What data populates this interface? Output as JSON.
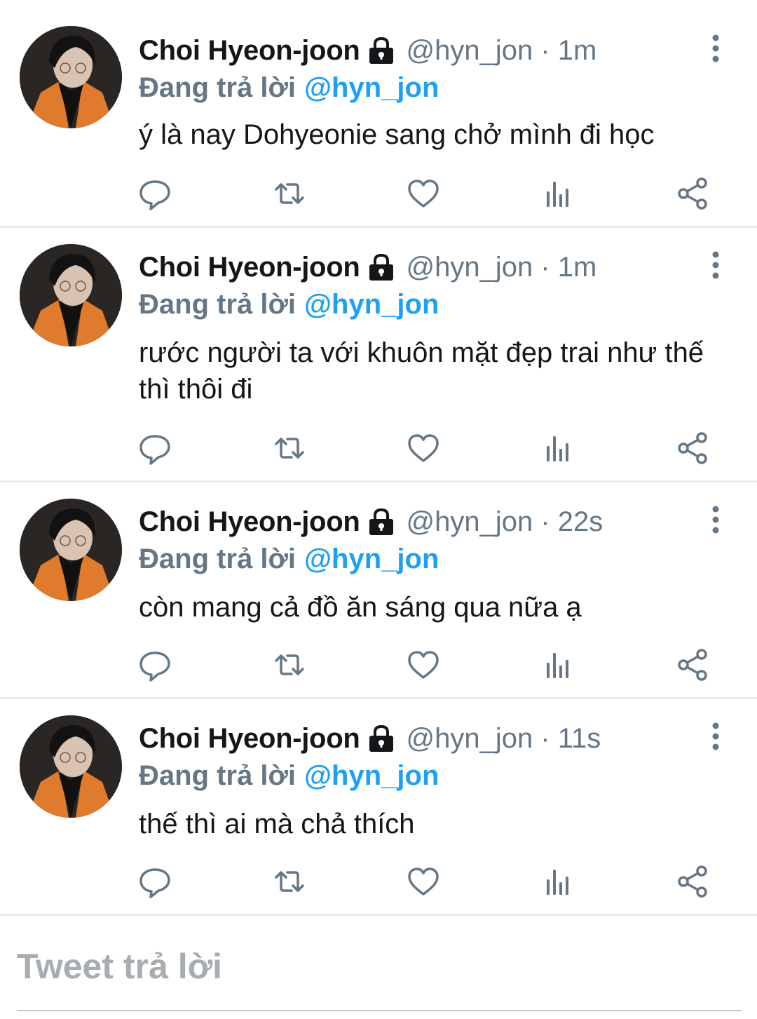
{
  "colors": {
    "text": "#14171a",
    "secondary": "#657786",
    "accent": "#1da1f2",
    "divider": "#e8ecef"
  },
  "tweets": [
    {
      "display_name": "Choi Hyeon-joon",
      "handle_time": "@hyn_jon · 1m",
      "reply_prefix": "Đang trả lời",
      "reply_target": "@hyn_jon",
      "text": "ý là nay Dohyeonie sang chở mình đi học"
    },
    {
      "display_name": "Choi Hyeon-joon",
      "handle_time": "@hyn_jon · 1m",
      "reply_prefix": "Đang trả lời",
      "reply_target": "@hyn_jon",
      "text": "rước người ta với khuôn mặt đẹp trai như thế thì thôi đi"
    },
    {
      "display_name": "Choi Hyeon-joon",
      "handle_time": "@hyn_jon · 22s",
      "reply_prefix": "Đang trả lời",
      "reply_target": "@hyn_jon",
      "text": "còn mang cả đồ ăn sáng qua nữa ạ"
    },
    {
      "display_name": "Choi Hyeon-joon",
      "handle_time": "@hyn_jon · 11s",
      "reply_prefix": "Đang trả lời",
      "reply_target": "@hyn_jon",
      "text": "thế thì ai mà chả thích"
    }
  ],
  "action_icons": [
    "reply-icon",
    "retweet-icon",
    "like-icon",
    "analytics-icon",
    "share-icon"
  ],
  "composer": {
    "placeholder": "Tweet trả lời"
  }
}
